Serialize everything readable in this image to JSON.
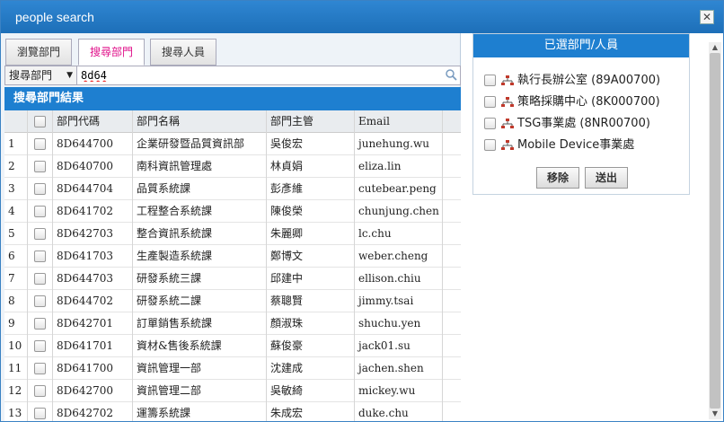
{
  "window": {
    "title": "people search",
    "close_glyph": "✕"
  },
  "tabs": [
    {
      "label": "瀏覽部門"
    },
    {
      "label": "搜尋部門",
      "active": true
    },
    {
      "label": "搜尋人員"
    }
  ],
  "search": {
    "scope": "搜尋部門",
    "value": "8d64"
  },
  "results": {
    "title": "搜尋部門結果",
    "columns": [
      "部門代碼",
      "部門名稱",
      "部門主管",
      "Email"
    ],
    "rows": [
      {
        "n": "1",
        "code": "8D644700",
        "name": "企業研發暨品質資訊部",
        "manager": "吳俊宏",
        "email": "junehung.wu"
      },
      {
        "n": "2",
        "code": "8D640700",
        "name": "南科資訊管理處",
        "manager": "林貞娟",
        "email": "eliza.lin"
      },
      {
        "n": "3",
        "code": "8D644704",
        "name": "品質系統課",
        "manager": "彭彥維",
        "email": "cutebear.peng"
      },
      {
        "n": "4",
        "code": "8D641702",
        "name": "工程整合系統課",
        "manager": "陳俊榮",
        "email": "chunjung.chen"
      },
      {
        "n": "5",
        "code": "8D642703",
        "name": "整合資訊系統課",
        "manager": "朱麗卿",
        "email": "lc.chu"
      },
      {
        "n": "6",
        "code": "8D641703",
        "name": "生產製造系統課",
        "manager": "鄭博文",
        "email": "weber.cheng"
      },
      {
        "n": "7",
        "code": "8D644703",
        "name": "研發系統三課",
        "manager": "邱建中",
        "email": "ellison.chiu"
      },
      {
        "n": "8",
        "code": "8D644702",
        "name": "研發系統二課",
        "manager": "蔡聰賢",
        "email": "jimmy.tsai"
      },
      {
        "n": "9",
        "code": "8D642701",
        "name": "訂單銷售系統課",
        "manager": "顏淑珠",
        "email": "shuchu.yen"
      },
      {
        "n": "10",
        "code": "8D641701",
        "name": "資材&售後系統課",
        "manager": "蘇俊豪",
        "email": "jack01.su"
      },
      {
        "n": "11",
        "code": "8D641700",
        "name": "資訊管理一部",
        "manager": "沈建成",
        "email": "jachen.shen"
      },
      {
        "n": "12",
        "code": "8D642700",
        "name": "資訊管理二部",
        "manager": "吳敏綺",
        "email": "mickey.wu"
      },
      {
        "n": "13",
        "code": "8D642702",
        "name": "運籌系統課",
        "manager": "朱成宏",
        "email": "duke.chu"
      }
    ]
  },
  "selected": {
    "title": "已選部門/人員",
    "items": [
      {
        "label": "執行長辦公室 (89A00700)"
      },
      {
        "label": "策略採購中心 (8K000700)"
      },
      {
        "label": "TSG事業處 (8NR00700)"
      },
      {
        "label": "Mobile Device事業處"
      }
    ],
    "remove_label": "移除",
    "send_label": "送出"
  },
  "colors": {
    "accent": "#1e7fd0",
    "active_tab_text": "#e0108a"
  },
  "icons": [
    "close-icon",
    "search-icon",
    "caret-down-icon",
    "org-chart-icon"
  ]
}
